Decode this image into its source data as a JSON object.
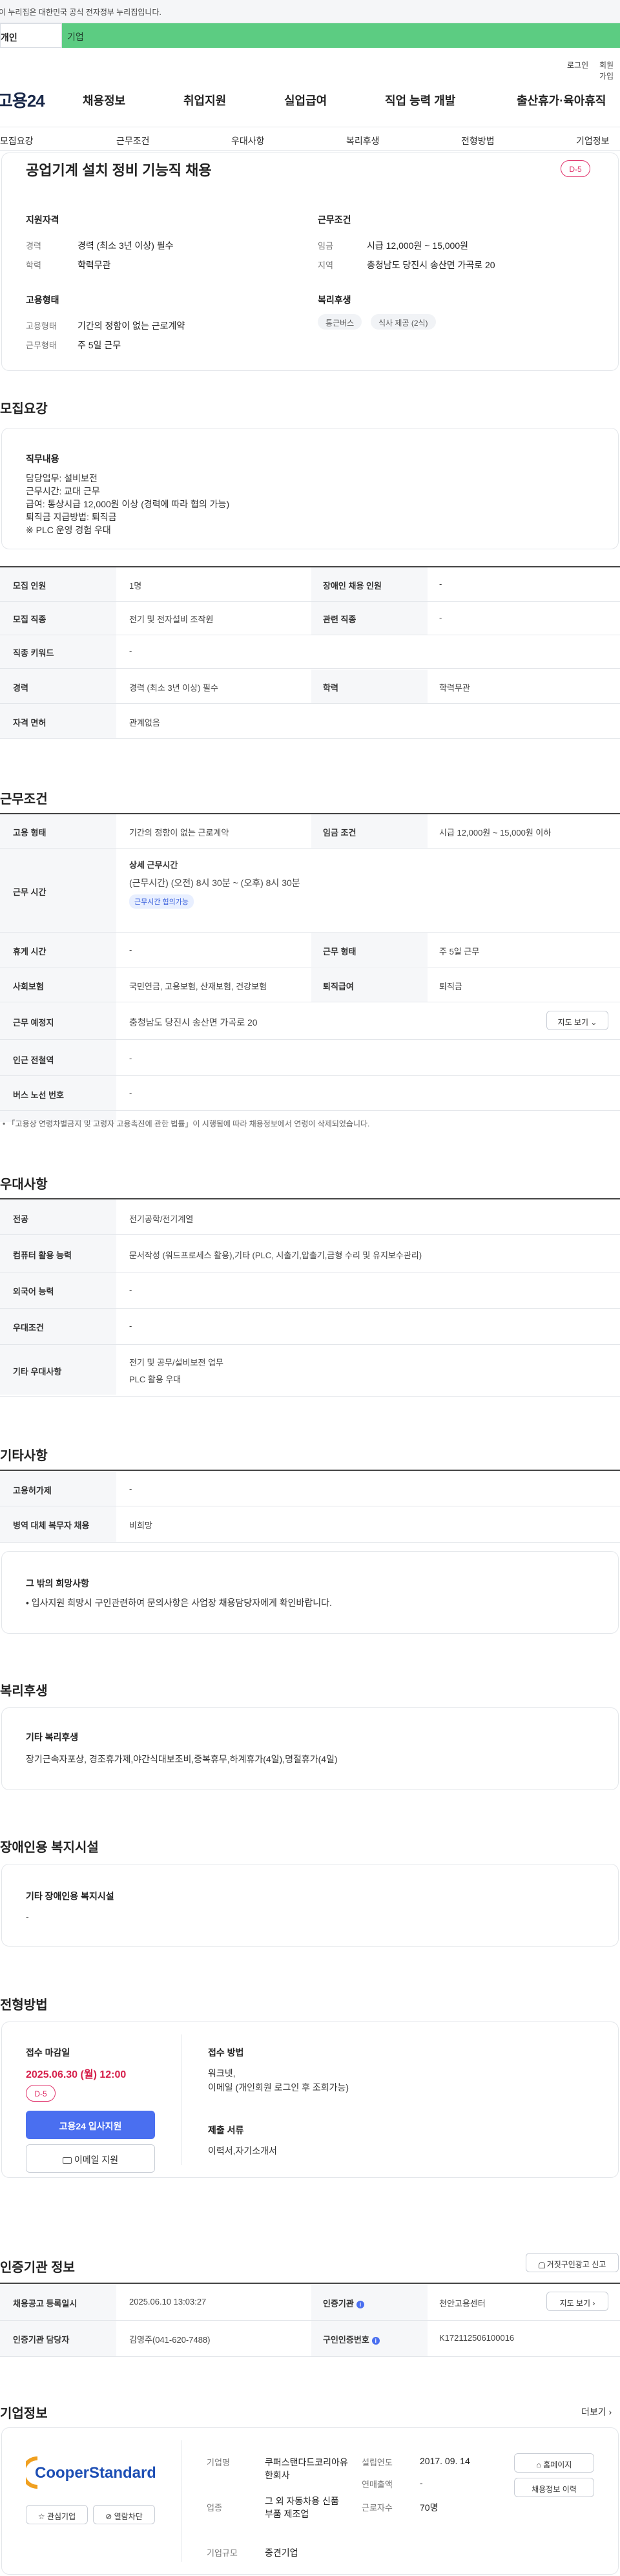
{
  "gov_banner": {
    "text": "이 누리집은 대한민국 공식 전자정부 누리집입니다."
  },
  "top_tabs": {
    "personal": "개인",
    "corp": "기업"
  },
  "util": {
    "login": "로그인",
    "join": "회원가입"
  },
  "header": {
    "logo": "고용24",
    "menu": [
      "채용정보",
      "취업지원",
      "실업급여",
      "직업 능력 개발",
      "출산휴가·육아휴직"
    ]
  },
  "subnav": [
    "모집요강",
    "근무조건",
    "우대사항",
    "복리후생",
    "전형방법",
    "기업정보"
  ],
  "summary": {
    "title": "공업기계 설치 정비 기능직 채용",
    "dday": "D-5",
    "qual_h": "지원자격",
    "cond_h": "근무조건",
    "type_h": "고용형태",
    "welfare_h": "복리후생",
    "career_k": "경력",
    "career_v": "경력 (최소 3년 이상) 필수",
    "edu_k": "학력",
    "edu_v": "학력무관",
    "wage_k": "임금",
    "wage_v": "시급 12,000원 ~ 15,000원",
    "region_k": "지역",
    "region_v": "충청남도 당진시 송산면 가곡로 20",
    "emp_k": "고용형태",
    "emp_v": "기간의 정함이 없는 근로계약",
    "work_k": "근무형태",
    "work_v": "주 5일 근무",
    "chips": [
      "통근버스",
      "식사 제공 (2식)"
    ]
  },
  "recruit": {
    "heading": "모집요강",
    "duty_h": "직무내용",
    "duty_lines": [
      "담당업무: 설비보전",
      "근무시간: 교대 근무",
      "급여: 통상시급 12,000원 이상 (경력에 따라 협의 가능)",
      "퇴직금 지급방법: 퇴직금",
      "※ PLC 운영 경험 우대"
    ],
    "rows": [
      {
        "k1": "모집 인원",
        "v1": "1명",
        "k2": "장애인 채용 인원",
        "v2": "-"
      },
      {
        "k1": "모집 직종",
        "v1": "전기 및 전자설비 조작원",
        "k2": "관련 직종",
        "v2": "-"
      },
      {
        "k1": "직종 키워드",
        "v1": "-"
      },
      {
        "k1": "경력",
        "v1": "경력 (최소 3년 이상) 필수",
        "k2": "학력",
        "v2": "학력무관"
      },
      {
        "k1": "자격 면허",
        "v1": "관계없음"
      }
    ]
  },
  "work": {
    "heading": "근무조건",
    "emp_k": "고용 형태",
    "emp_v": "기간의 정함이 없는 근로계약",
    "wage_k": "임금 조건",
    "wage_v": "시급 12,000원 ~ 15,000원 이하",
    "time_k": "근무 시간",
    "time_sub": "상세 근무시간",
    "time_v": "(근무시간) (오전) 8시 30분 ~ (오후) 8시 30분",
    "time_badge": "근무시간 협의가능",
    "rest_k": "휴게 시간",
    "rest_v": "-",
    "form_k": "근무 형태",
    "form_v": "주 5일 근무",
    "ins_k": "사회보험",
    "ins_v": "국민연금, 고용보험, 산재보험, 건강보험",
    "ret_k": "퇴직급여",
    "ret_v": "퇴직금",
    "place_k": "근무 예정지",
    "place_v": "충청남도 당진시 송산면 가곡로 20",
    "map_btn": "지도 보기 ⌄",
    "sub_k": "인근 전철역",
    "sub_v": "-",
    "bus_k": "버스 노선 번호",
    "bus_v": "-",
    "note": "「고용상 연령차별금지 및 고령자 고용촉진에 관한 법률」이 시행됨에 따라 채용정보에서 연령이 삭제되었습니다."
  },
  "pref": {
    "heading": "우대사항",
    "major_k": "전공",
    "major_v": "전기공학/전기계열",
    "pc_k": "컴퓨터 활용 능력",
    "pc_v": "문서작성 (워드프로세스 활용),기타 (PLC, 시출기,압출기,금형 수리 및 유지보수관리)",
    "lang_k": "외국어 능력",
    "lang_v": "-",
    "cond_k": "우대조건",
    "cond_v": "-",
    "etc_k": "기타 우대사항",
    "etc_v1": "전기 및 공무/설비보전 업무",
    "etc_v2": "PLC 활용 우대"
  },
  "other": {
    "heading": "기타사항",
    "grant_k": "고용허가제",
    "grant_v": "-",
    "mil_k": "병역 대체 복무자 채용",
    "mil_v": "비희망",
    "hope_h": "그 밖의 희망사항",
    "hope_v": "• 입사지원 희망시 구인관련하여 문의사항은 사업장 채용담당자에게 확인바랍니다."
  },
  "welfare": {
    "heading": "복리후생",
    "h": "기타 복리후생",
    "v": "장기근속자포상, 경조휴가제,야간식대보조비,중복휴무,하계휴가(4일),명절휴가(4일)"
  },
  "disabled": {
    "heading": "장애인용 복지시설",
    "h": "기타 장애인용 복지시설",
    "v": "-"
  },
  "process": {
    "heading": "전형방법",
    "deadline_h": "접수 마감일",
    "deadline_v": "2025.06.30 (월) 12:00",
    "dday": "D-5",
    "apply_btn": "고용24 입사지원",
    "email_btn": "이메일 지원",
    "method_h": "접수 방법",
    "method_v1": "워크넷,",
    "method_v2": "이메일 (개인회원 로그인 후 조회가능)",
    "docs_h": "제출 서류",
    "docs_v": "이력서,자기소개서"
  },
  "agency": {
    "heading": "인증기관 정보",
    "report_btn": "거짓구인광고 신고",
    "reg_k": "채용공고 등록일시",
    "reg_v": "2025.06.10 13:03:27",
    "org_k": "인증기관",
    "org_v": "천안고용센터",
    "map_btn": "지도 보기 ›",
    "mgr_k": "인증기관 담당자",
    "mgr_v": "김영주(041-620-7488)",
    "num_k": "구인인증번호",
    "num_v": "K172112506100016"
  },
  "company": {
    "heading": "기업정보",
    "more": "더보기 ›",
    "logo_text": "CooperStandard",
    "fav_btn": "관심기업",
    "block_btn": "열람차단",
    "name_k": "기업명",
    "name_v": "쿠퍼스탠다드코리아유한회사",
    "ind_k": "업종",
    "ind_v": "그 외 자동차용 신품 부품 제조업",
    "size_k": "기업규모",
    "size_v": "중견기업",
    "est_k": "설립연도",
    "est_v": "2017. 09. 14",
    "rev_k": "연매출액",
    "rev_v": "-",
    "emp_k": "근로자수",
    "emp_v": "70명",
    "home_btn": "홈페이지",
    "hist_btn": "채용정보 이력"
  }
}
